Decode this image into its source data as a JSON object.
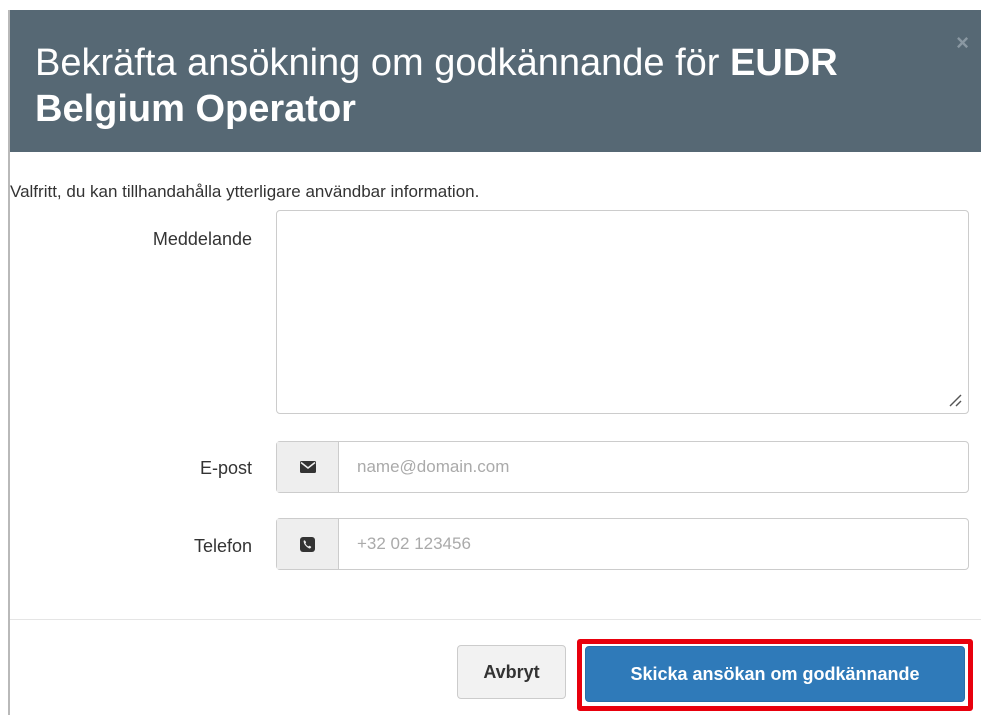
{
  "dialog": {
    "title_prefix": "Bekräfta ansökning om godkännande för ",
    "title_bold": "EUDR Belgium Operator",
    "close_label": "×",
    "help_text": "Valfritt, du kan tillhandahålla ytterligare användbar information."
  },
  "form": {
    "message": {
      "label": "Meddelande",
      "value": ""
    },
    "email": {
      "label": "E-post",
      "placeholder": "name@domain.com",
      "icon": "envelope-icon"
    },
    "phone": {
      "label": "Telefon",
      "placeholder": "+32 02 123456",
      "icon": "phone-square-icon"
    }
  },
  "footer": {
    "cancel_label": "Avbryt",
    "submit_label": "Skicka ansökan om godkännande"
  },
  "colors": {
    "header_bg": "#566874",
    "primary": "#2f7ab9",
    "highlight": "#e8000d"
  }
}
